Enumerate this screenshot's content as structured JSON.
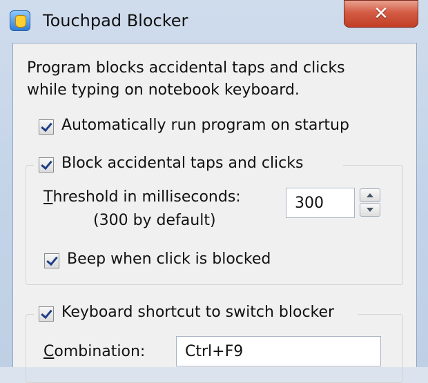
{
  "window": {
    "title": "Touchpad Blocker",
    "app_icon": "touchpad-hand-icon",
    "close_glyph": "✕"
  },
  "description": {
    "line1": "Program blocks accidental taps and clicks",
    "line2": "while typing on notebook keyboard."
  },
  "options": {
    "autorun": {
      "label": "Automatically run program on startup",
      "checked": true
    },
    "block": {
      "label": "Block accidental taps and clicks",
      "checked": true
    },
    "threshold": {
      "label_first": "T",
      "label_rest": "hreshold in milliseconds:",
      "hint": "(300 by default)",
      "value": "300"
    },
    "beep": {
      "label": "Beep when click is blocked",
      "checked": true
    },
    "shortcut": {
      "label": "Keyboard shortcut to switch blocker",
      "checked": true
    },
    "combination": {
      "label_first": "C",
      "label_rest": "ombination:",
      "value": "Ctrl+F9"
    }
  },
  "colors": {
    "close_button": "#c9442b",
    "window_frame": "#c2d3e8",
    "client_bg": "#f0f0f0"
  }
}
